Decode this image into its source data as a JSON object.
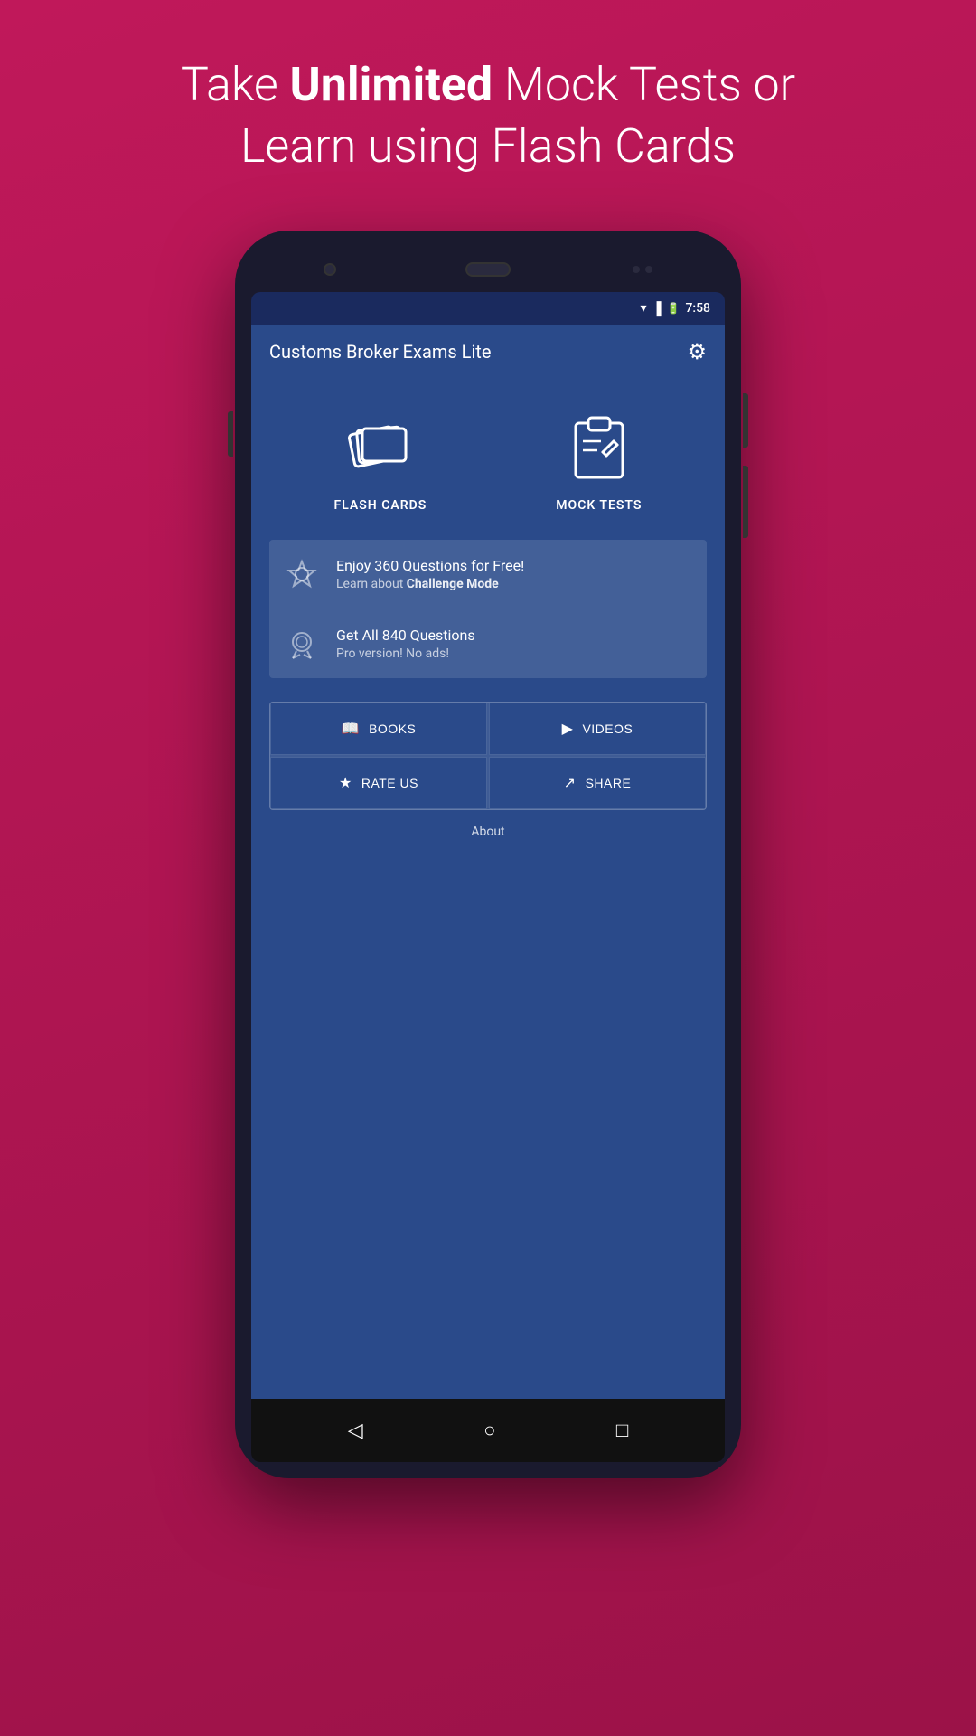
{
  "header": {
    "line1": "Take ",
    "line1_bold": "Unlimited",
    "line1_end": " Mock Tests or",
    "line2": "Learn using Flash Cards"
  },
  "statusBar": {
    "time": "7:58"
  },
  "appToolbar": {
    "title": "Customs Broker Exams Lite",
    "settingsIcon": "⚙"
  },
  "mainMenu": {
    "items": [
      {
        "id": "flash-cards",
        "label": "FLASH CARDS"
      },
      {
        "id": "mock-tests",
        "label": "MOCK TESTS"
      }
    ]
  },
  "infoPanels": [
    {
      "id": "free-questions",
      "title": "Enjoy 360 Questions for Free!",
      "subtitle": "Learn about ",
      "subtitleBold": "Challenge Mode"
    },
    {
      "id": "pro-questions",
      "title": "Get All 840 Questions",
      "subtitle": "Pro version! No ads!"
    }
  ],
  "actionButtons": [
    {
      "id": "books",
      "label": "BOOKS",
      "icon": "📖"
    },
    {
      "id": "videos",
      "label": "VIDEOS",
      "icon": "▶"
    },
    {
      "id": "rate-us",
      "label": "RATE US",
      "icon": "★"
    },
    {
      "id": "share",
      "label": "SHARE",
      "icon": "↗"
    }
  ],
  "aboutLink": "About",
  "navBar": {
    "back": "◁",
    "home": "○",
    "recent": "□"
  }
}
